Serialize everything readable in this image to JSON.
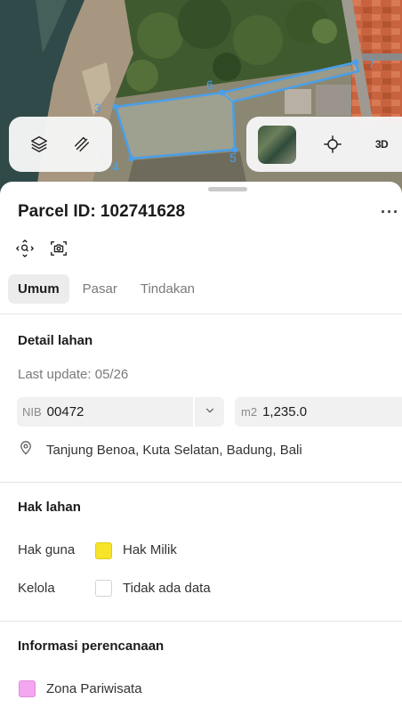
{
  "map": {
    "vertex_labels": [
      "3",
      "4",
      "5",
      "6",
      "7"
    ],
    "controls": {
      "layers_icon": "layers-icon",
      "draw_icon": "draw-parcel-icon",
      "locate_icon": "crosshair-icon",
      "mode_3d_label": "3D"
    },
    "colors": {
      "parcel_outline": "#4a9fe8"
    }
  },
  "sheet": {
    "title": "Parcel ID: 102741628",
    "more_label": "···",
    "tabs": [
      {
        "label": "Umum",
        "active": true
      },
      {
        "label": "Pasar",
        "active": false
      },
      {
        "label": "Tindakan",
        "active": false
      }
    ],
    "detail": {
      "title": "Detail lahan",
      "last_update": "Last update: 05/26",
      "nib_label": "NIB",
      "nib_value": "00472",
      "area_unit": "m2",
      "area_value": "1,235.0",
      "location": "Tanjung Benoa, Kuta Selatan, Badung, Bali"
    },
    "rights": {
      "title": "Hak lahan",
      "rows": [
        {
          "label": "Hak guna",
          "value": "Hak Milik",
          "color": "#f7e42a"
        },
        {
          "label": "Kelola",
          "value": "Tidak ada data",
          "color": "#ffffff"
        }
      ]
    },
    "planning": {
      "title": "Informasi perencanaan",
      "zone": {
        "value": "Zona Pariwisata",
        "color": "#f4a6f0"
      }
    }
  }
}
